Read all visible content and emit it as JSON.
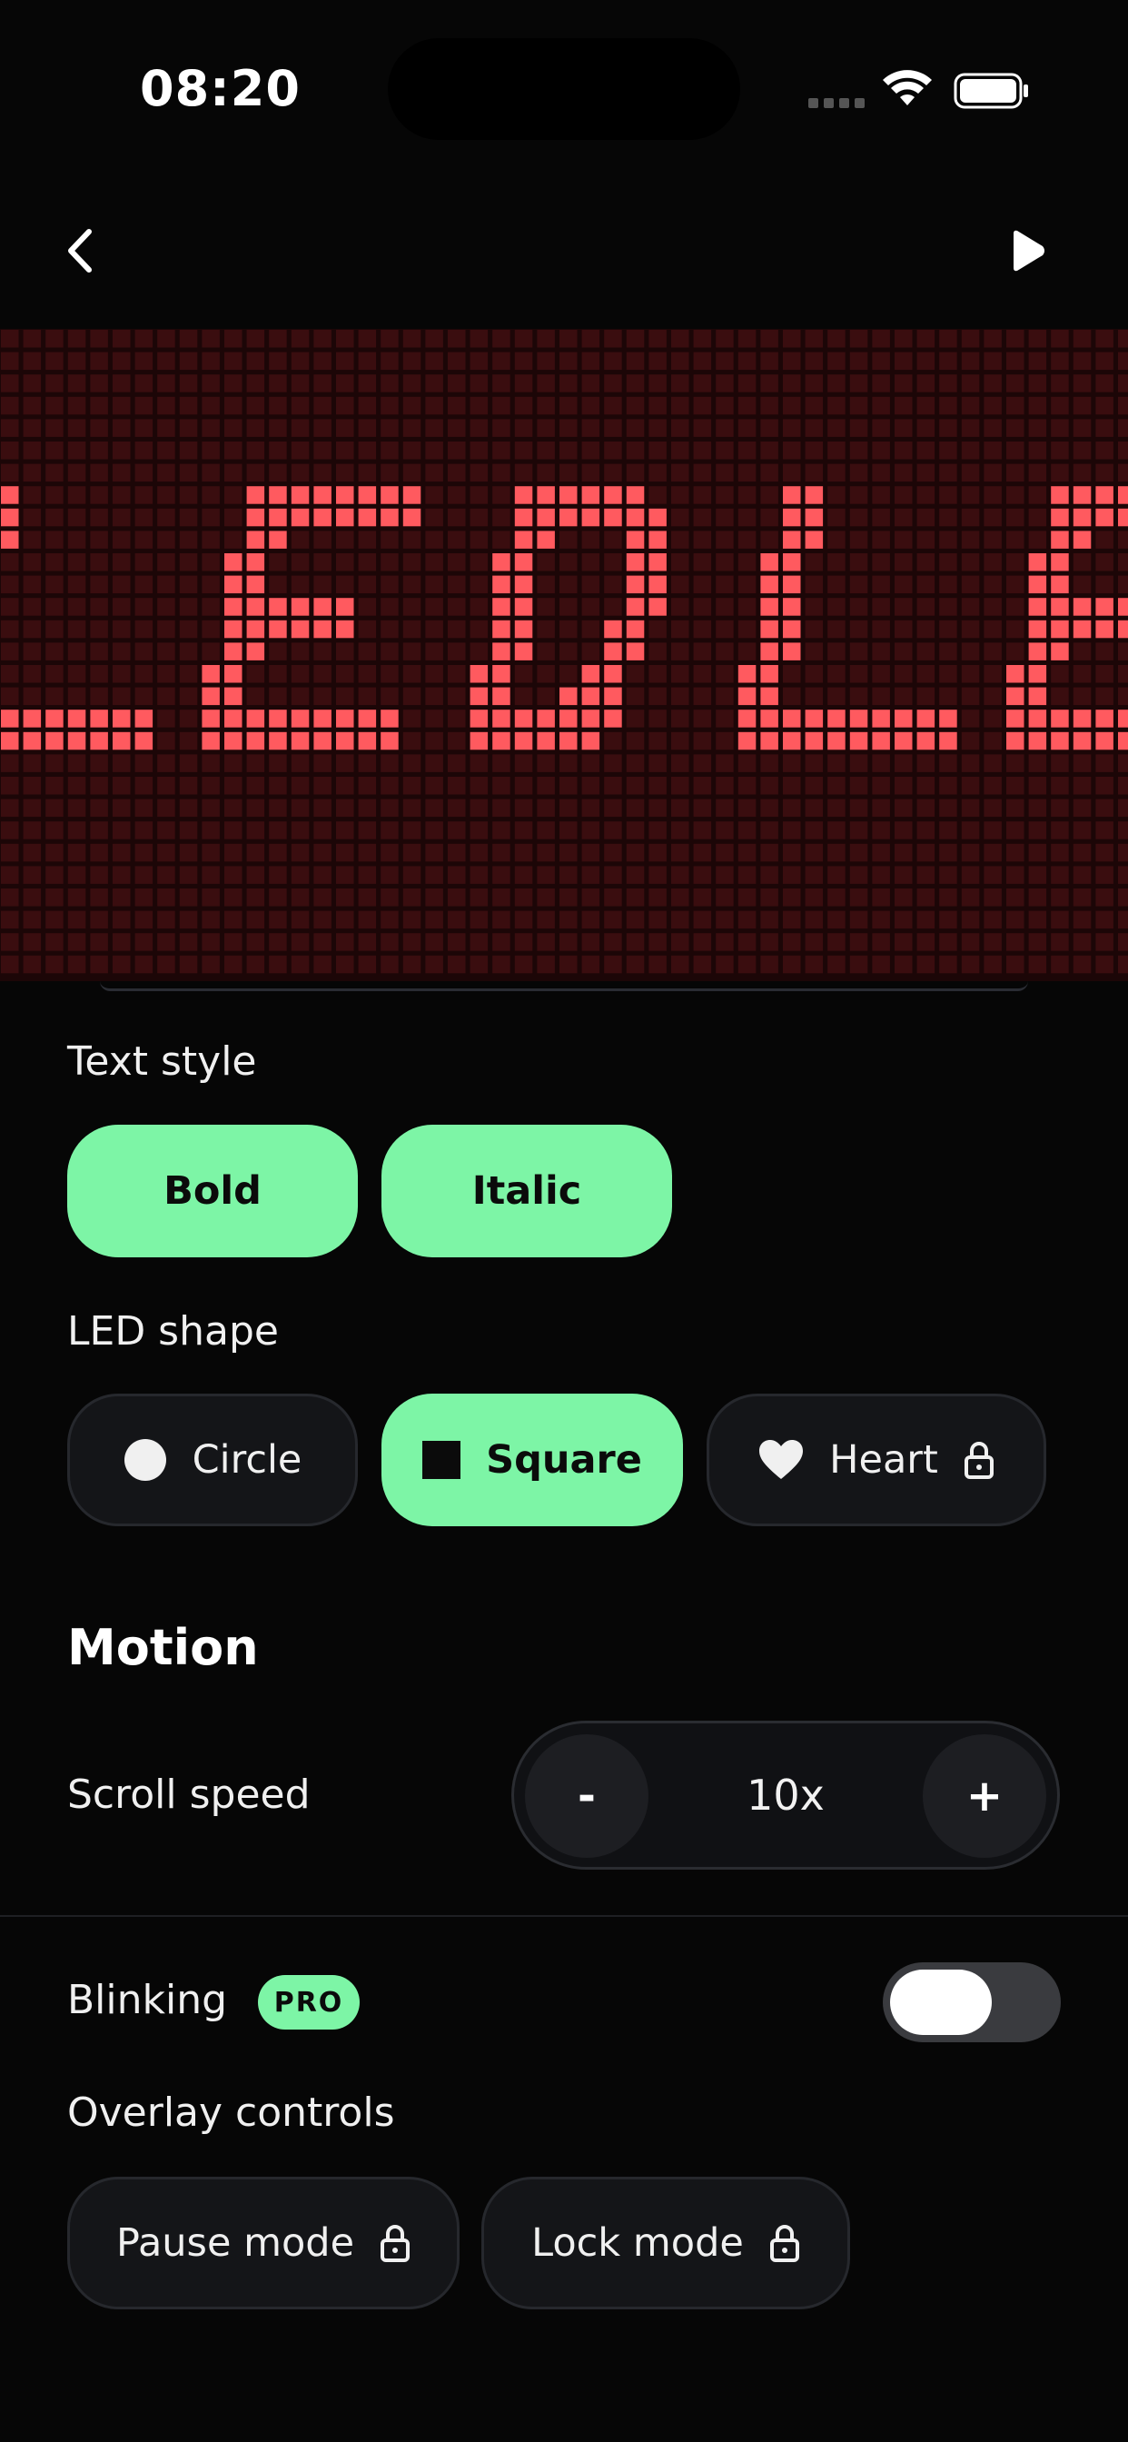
{
  "status_bar": {
    "time": "08:20"
  },
  "nav": {
    "back_icon": "chevron-left-icon",
    "play_icon": "play-icon"
  },
  "preview": {
    "text": "LED",
    "led_color": "#ff5a5f",
    "off_color": "#3a0d0f",
    "background": "#1c0607"
  },
  "text_style": {
    "label": "Text style",
    "options": [
      {
        "label": "Bold",
        "active": true
      },
      {
        "label": "Italic",
        "active": true
      }
    ]
  },
  "led_shape": {
    "label": "LED shape",
    "options": [
      {
        "label": "Circle",
        "icon": "circle-icon",
        "active": false,
        "locked": false
      },
      {
        "label": "Square",
        "icon": "square-icon",
        "active": true,
        "locked": false
      },
      {
        "label": "Heart",
        "icon": "heart-icon",
        "active": false,
        "locked": true
      }
    ]
  },
  "motion": {
    "title": "Motion",
    "scroll_speed": {
      "label": "Scroll speed",
      "minus": "-",
      "value": "10x",
      "plus": "+"
    }
  },
  "blinking": {
    "label": "Blinking",
    "badge": "PRO",
    "enabled": false
  },
  "overlay_controls": {
    "label": "Overlay controls",
    "options": [
      {
        "label": "Pause mode",
        "icon": "lock-icon",
        "locked": true
      },
      {
        "label": "Lock mode",
        "icon": "lock-icon",
        "locked": true
      }
    ]
  },
  "colors": {
    "accent": "#7df5a6",
    "background": "#060606",
    "surface": "#141518"
  }
}
